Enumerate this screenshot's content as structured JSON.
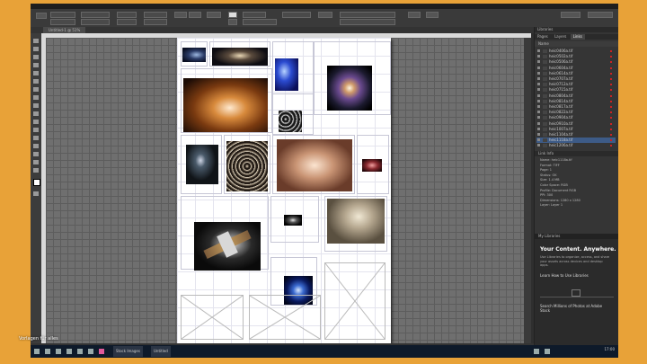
{
  "document": {
    "tab_label": "Untitled-1 @ 51%",
    "zoom": "51%"
  },
  "watermark": "Vorlagen für alles",
  "panel": {
    "title": "Libraries",
    "tabs": [
      "Pages",
      "Layers",
      "Links"
    ],
    "active_tab": "Links",
    "links_header": "Name",
    "layer_items": [
      "heic0406a.tif",
      "heic0502a.tif",
      "heic0506a.tif",
      "heic0604a.tif",
      "heic0614a.tif",
      "heic0707a.tif",
      "heic0712a.tif",
      "heic0715a.tif",
      "heic0804a.tif",
      "heic0814a.tif",
      "heic0817a.tif",
      "heic0822a.tif",
      "heic0904a.tif",
      "heic0910a.tif",
      "heic1007a.tif",
      "heic1104a.tif",
      "heic1118a.tif",
      "heic1206a.tif"
    ],
    "selected_layer_index": 16,
    "info_label": "Link Info",
    "info_rows": [
      "Name: heic1118a.tif",
      "Format: TIFF",
      "Page: 1",
      "Status: OK",
      "Size: 1.4 MB",
      "Color Space: RGB",
      "Profile: Document RGB",
      "PPI: 300",
      "Dimensions: 1280 x 1280",
      "Layer: Layer 1"
    ],
    "cc": {
      "header": "My Libraries",
      "title": "Your Content. Anywhere.",
      "body": "Use Libraries to organize, access, and share your assets across devices and desktop apps.",
      "link1": "Learn How to Use Libraries",
      "link2": "Search Millions of Photos at Adobe Stock"
    }
  },
  "taskbar": {
    "items": [
      "Stock Images",
      "Untitled"
    ],
    "time": "17:00",
    "date": "01.01.2016"
  },
  "colors": {
    "border": "#e8a238",
    "app_bg": "#2f2f2f",
    "pasteboard": "#6f6f6f",
    "selection": "#3d5b87",
    "taskbar": "#0e1a2a"
  }
}
